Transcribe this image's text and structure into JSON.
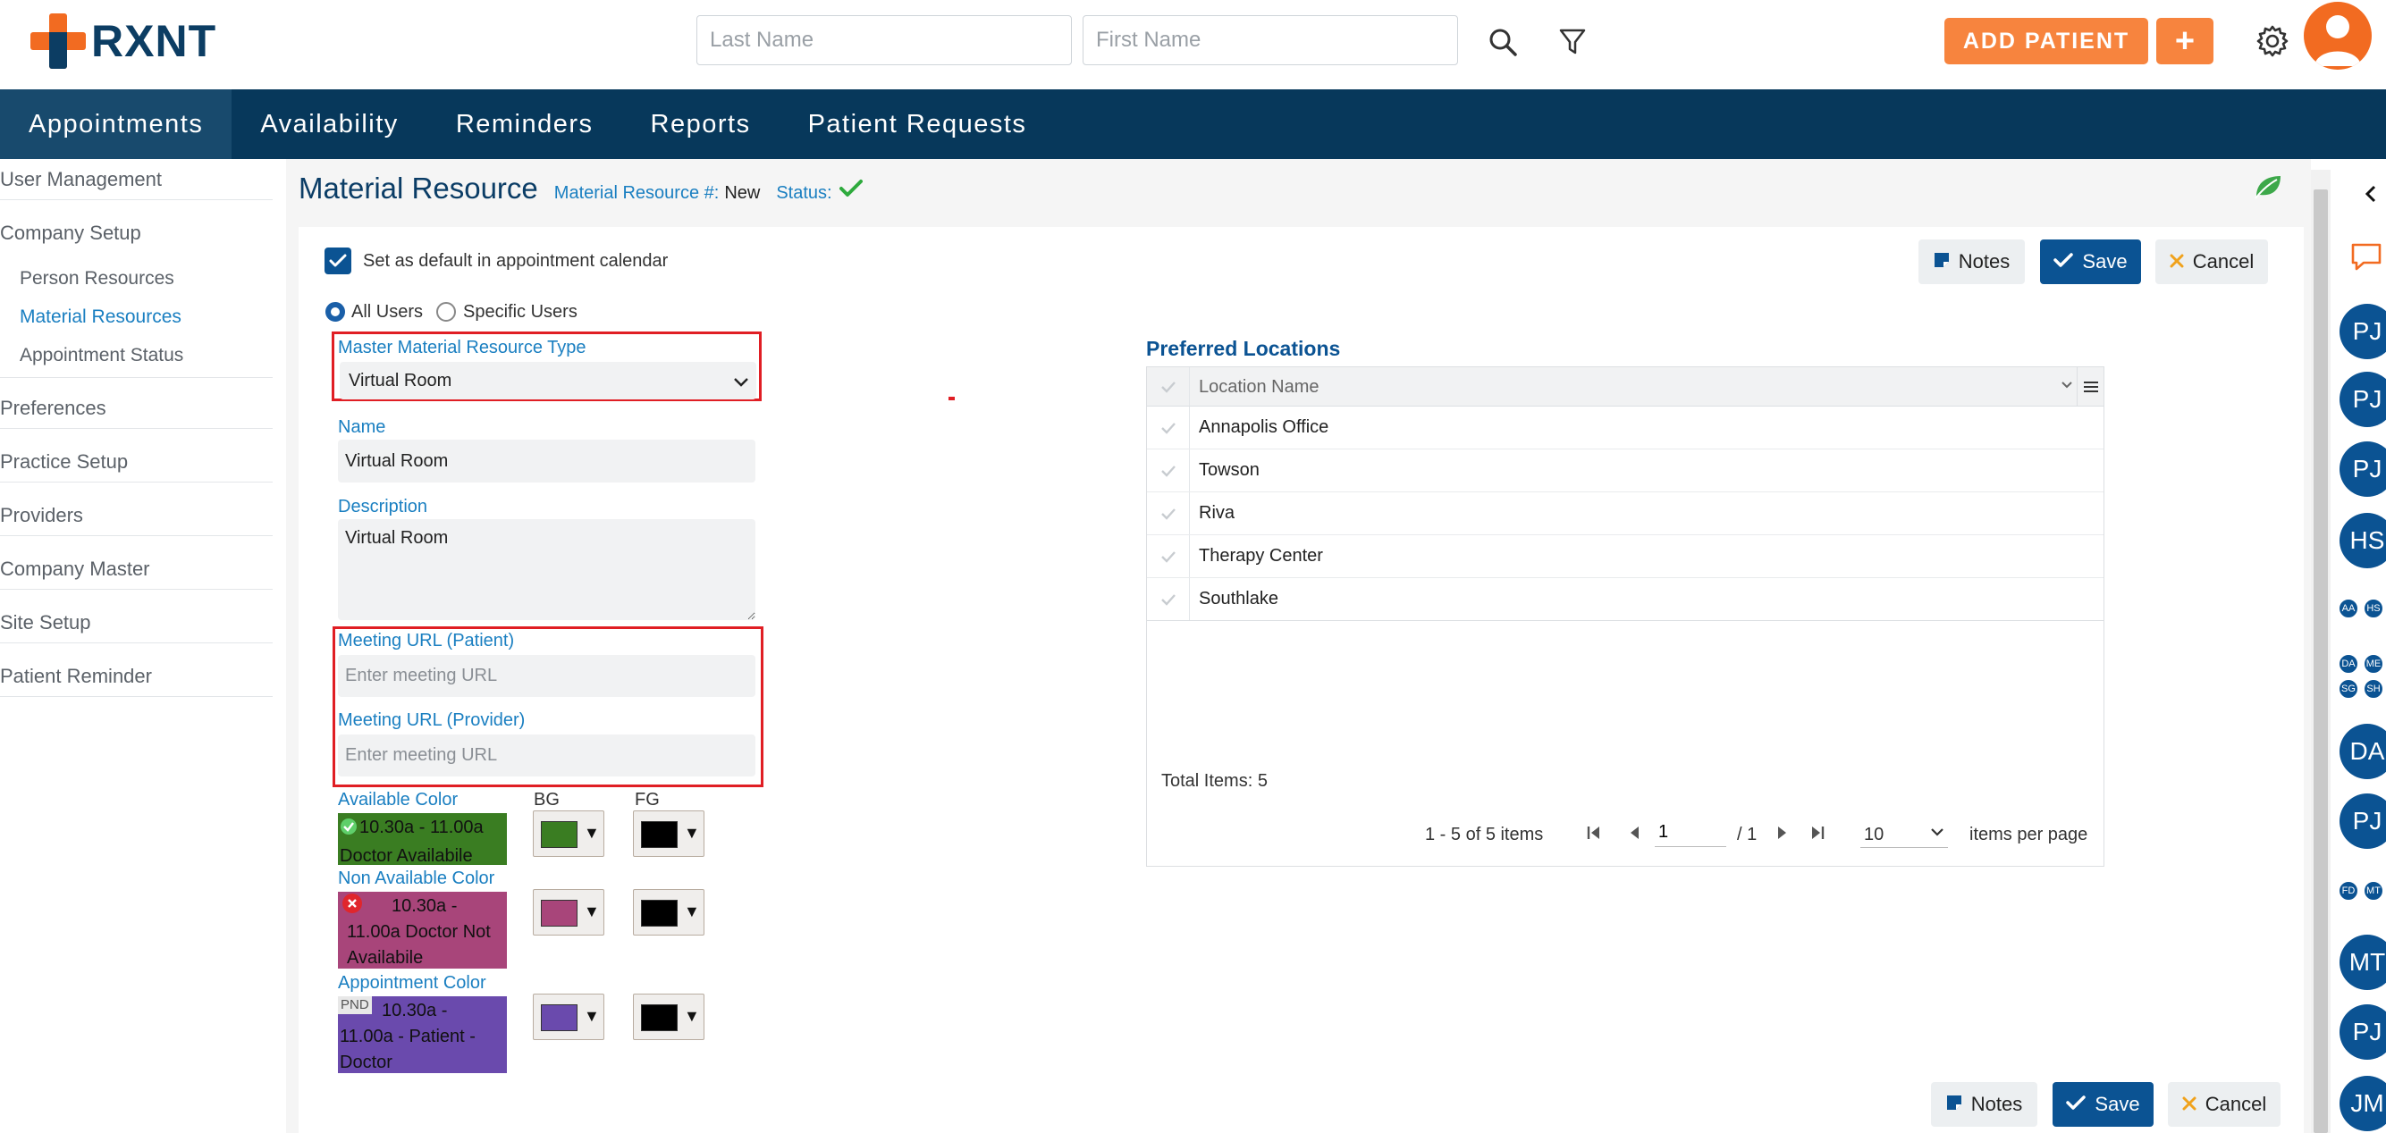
{
  "header": {
    "logo_text": "RXNT",
    "last_name_placeholder": "Last Name",
    "first_name_placeholder": "First Name",
    "add_patient_label": "ADD PATIENT",
    "plus_label": "+"
  },
  "nav": {
    "items": [
      {
        "label": "Appointments"
      },
      {
        "label": "Availability"
      },
      {
        "label": "Reminders"
      },
      {
        "label": "Reports"
      },
      {
        "label": "Patient Requests"
      }
    ]
  },
  "sidebar": {
    "user_management": "User Management",
    "company_setup": "Company Setup",
    "person_resources": "Person Resources",
    "material_resources": "Material Resources",
    "appointment_status": "Appointment Status",
    "preferences": "Preferences",
    "practice_setup": "Practice Setup",
    "providers": "Providers",
    "company_master": "Company Master",
    "site_setup": "Site Setup",
    "patient_reminder": "Patient Reminder"
  },
  "page": {
    "title": "Material Resource",
    "resource_num_label": "Material Resource #:",
    "resource_num_value": "New",
    "status_label": "Status:"
  },
  "form": {
    "default_checkbox_label": "Set as default in appointment calendar",
    "all_users": "All Users",
    "specific_users": "Specific Users",
    "master_type_label": "Master Material Resource Type",
    "master_type_value": "Virtual Room",
    "name_label": "Name",
    "name_value": "Virtual Room",
    "description_label": "Description",
    "description_value": "Virtual Room",
    "meeting_patient_label": "Meeting URL (Patient)",
    "meeting_provider_label": "Meeting URL (Provider)",
    "meeting_placeholder": "Enter meeting URL",
    "available_color_label": "Available Color",
    "bg_label": "BG",
    "fg_label": "FG",
    "available_sample": "10.30a - 11.00a Doctor Availabile",
    "non_available_color_label": "Non Available Color",
    "non_available_sample": "10.30a - 11.00a Doctor Not Availabile",
    "appointment_color_label": "Appointment Color",
    "appointment_badge": "PND",
    "appointment_sample": "10.30a - 11.00a - Patient - Doctor",
    "colors": {
      "available_bg": "#3a7d22",
      "non_available_bg": "#a8457a",
      "appointment_bg": "#6a4aad",
      "fg": "#000000"
    }
  },
  "buttons": {
    "notes": "Notes",
    "save": "Save",
    "cancel": "Cancel"
  },
  "locations": {
    "title": "Preferred Locations",
    "column_header": "Location Name",
    "rows": [
      "Annapolis Office",
      "Towson",
      "Riva",
      "Therapy Center",
      "Southlake"
    ],
    "total_items": "Total Items: 5",
    "range_text": "1 - 5 of 5 items",
    "page_value": "1",
    "page_total": "/ 1",
    "page_size": "10",
    "items_per_page": "items per page"
  },
  "rail": {
    "avatars": [
      "PJ",
      "PJ",
      "PJ",
      "HS",
      "AA",
      "HS",
      "DA",
      "ME",
      "SG",
      "SH",
      "DA",
      "PJ",
      "FD",
      "MT",
      "MT",
      "PJ",
      "JM"
    ]
  }
}
